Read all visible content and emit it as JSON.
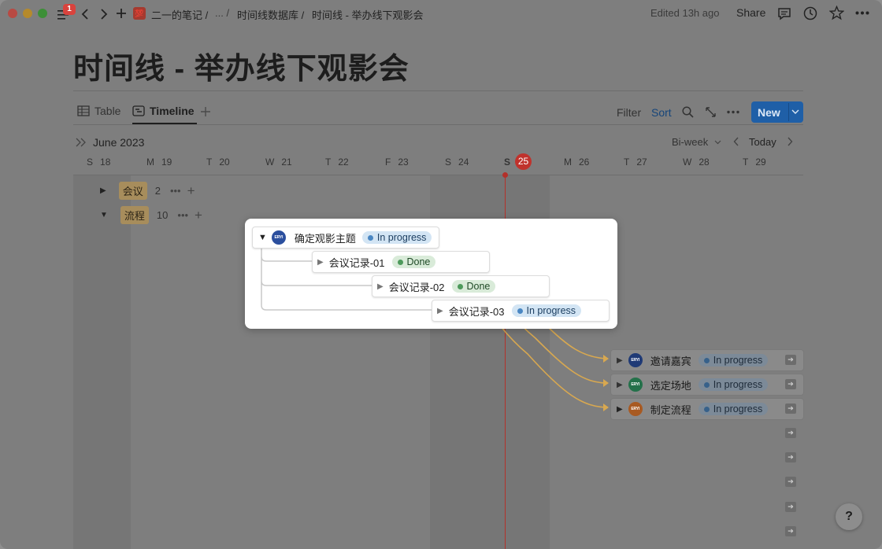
{
  "titlebar": {
    "badge": "1",
    "breadcrumb": [
      "二一的笔记 /",
      "... /",
      "时间线数据库 /",
      "时间线 - 举办线下观影会"
    ],
    "edited": "Edited 13h ago",
    "share": "Share"
  },
  "page": {
    "title": "时间线 - 举办线下观影会"
  },
  "views": {
    "tabs": [
      "Table",
      "Timeline"
    ],
    "filter": "Filter",
    "sort": "Sort",
    "new": "New"
  },
  "timeline": {
    "month": "June 2023",
    "range": "Bi-week",
    "today": "Today",
    "days": [
      {
        "w": "S",
        "d": "18"
      },
      {
        "w": "M",
        "d": "19"
      },
      {
        "w": "T",
        "d": "20"
      },
      {
        "w": "W",
        "d": "21"
      },
      {
        "w": "T",
        "d": "22"
      },
      {
        "w": "F",
        "d": "23"
      },
      {
        "w": "S",
        "d": "24"
      },
      {
        "w": "S",
        "d": "25"
      },
      {
        "w": "M",
        "d": "26"
      },
      {
        "w": "T",
        "d": "27"
      },
      {
        "w": "W",
        "d": "28"
      },
      {
        "w": "T",
        "d": "29"
      }
    ]
  },
  "groups": [
    {
      "name": "会议",
      "count": "2"
    },
    {
      "name": "流程",
      "count": "10"
    }
  ],
  "popup": {
    "parent": {
      "title": "确定观影主题",
      "status": "In progress",
      "avatar": "ERYI"
    },
    "children": [
      {
        "title": "会议记录-01",
        "status": "Done"
      },
      {
        "title": "会议记录-02",
        "status": "Done"
      },
      {
        "title": "会议记录-03",
        "status": "In progress"
      }
    ]
  },
  "right_items": [
    {
      "title": "邀请嘉宾",
      "status": "In progress",
      "avatar": "ERYI",
      "color": "#2b4f9e"
    },
    {
      "title": "选定场地",
      "status": "In progress",
      "avatar": "ERYI",
      "color": "#2e8a59"
    },
    {
      "title": "制定流程",
      "status": "In progress",
      "avatar": "ERYI",
      "color": "#c46c2b"
    }
  ],
  "help": "?"
}
